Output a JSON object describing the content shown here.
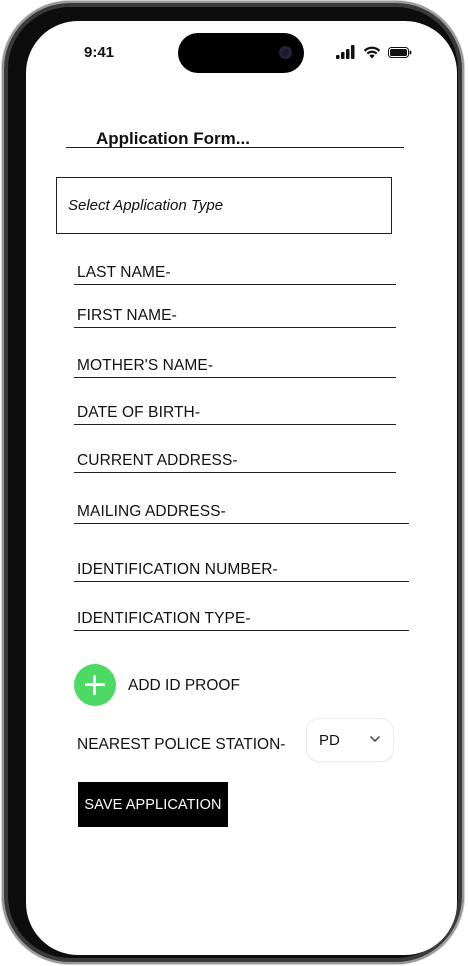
{
  "status_bar": {
    "time": "9:41"
  },
  "form": {
    "title": "Application Form...",
    "application_type_placeholder": "Select Application Type",
    "fields": [
      "LAST NAME-",
      "FIRST NAME-",
      "MOTHER'S NAME-",
      "DATE OF BIRTH-",
      "CURRENT ADDRESS-",
      "MAILING ADDRESS-",
      "IDENTIFICATION NUMBER-",
      "IDENTIFICATION TYPE-"
    ],
    "add_id_proof_label": "ADD ID PROOF",
    "police_station_label": "NEAREST POLICE STATION-",
    "police_station_value": "PD",
    "save_label": "SAVE APPLICATION"
  },
  "colors": {
    "add_button": "#4cd964",
    "save_button_bg": "#000000",
    "save_button_text": "#ffffff"
  },
  "icons": [
    "signal-icon",
    "wifi-icon",
    "battery-icon",
    "plus-icon",
    "chevron-down-icon"
  ]
}
